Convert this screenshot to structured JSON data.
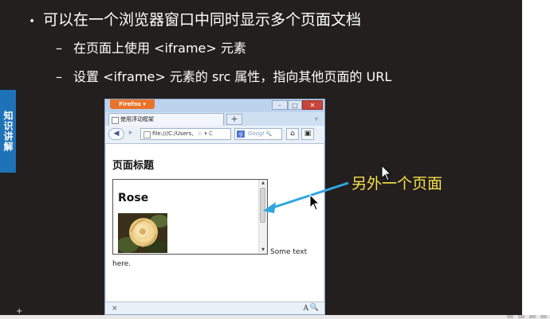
{
  "slide": {
    "bullet1": "可以在一个浏览器窗口中同时显示多个页面文档",
    "bullet1_marker": "•",
    "sub_marker": "–",
    "sub1": "在页面上使用 <iframe> 元素",
    "sub2": "设置 <iframe> 元素的 src 属性，指向其他页面的 URL",
    "side_tag": "知识讲解",
    "annotation": "另外一个页面"
  },
  "browser": {
    "menu_button": "Firefox ▾",
    "tab_title": "使用浮动框架",
    "new_tab": "+",
    "list_tabs": "▿",
    "minimize": "–",
    "maximize": "□",
    "close": "✕",
    "back": "◀",
    "forward": "▸",
    "url": "file:///C:/Users,",
    "url_icons": "☆ ▾ C",
    "search_placeholder": "Googl",
    "search_engine": "g",
    "search_glass": "🔍",
    "home": "⌂",
    "bookmarks": "▣",
    "page_heading": "页面标题",
    "iframe_heading": "Rose",
    "text_after_iframe": "Some text",
    "text_wrap": "here.",
    "status_close": "×",
    "status_font": "A",
    "status_zoom": "🔍"
  },
  "colors": {
    "slide_bg": "#231f1f",
    "tag_bg": "#1e72b8",
    "annotation": "#f5e04a",
    "arrow": "#2ea7e0",
    "firefox_orange": "#e8742a"
  },
  "icons": {
    "side_tag": "label-tag",
    "pointer": "mouse-pointer-icon",
    "arrow": "annotation-arrow"
  }
}
